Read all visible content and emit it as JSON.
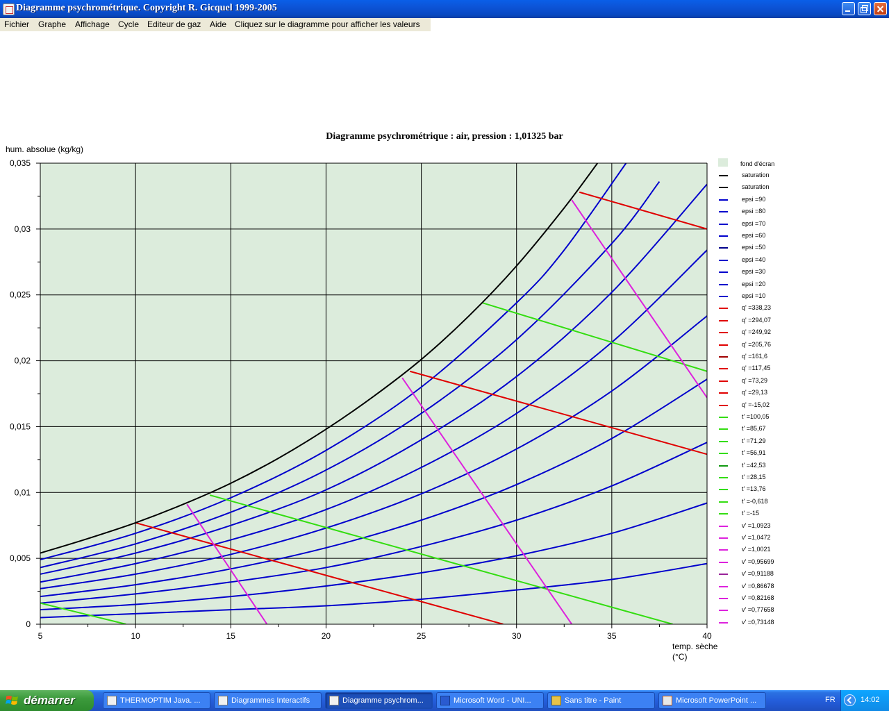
{
  "window": {
    "title": "Diagramme psychrométrique.    Copyright R. Gicquel 1999-2005"
  },
  "menu": {
    "items": [
      "Fichier",
      "Graphe",
      "Affichage",
      "Cycle",
      "Editeur de gaz",
      "Aide",
      "Cliquez sur le diagramme pour afficher les valeurs"
    ]
  },
  "colors": {
    "plot_bg": "#dcecdc",
    "grid": "#000000",
    "saturation": "#000000",
    "epsi": "#0000cc",
    "q": "#e00000",
    "t": "#33dd11",
    "v": "#dd22dd"
  },
  "chart_data": {
    "type": "line",
    "title": "Diagramme psychrométrique : air,  pression : 1,01325 bar",
    "xlabel_line1": "temp. sèche",
    "xlabel_line2": "(°C)",
    "ylabel": "hum. absolue (kg/kg)",
    "xlim": [
      5,
      40
    ],
    "ylim": [
      0,
      0.035
    ],
    "x_ticks": [
      "5",
      "10",
      "15",
      "20",
      "25",
      "30",
      "35",
      "40"
    ],
    "y_ticks": [
      "0",
      "0,005",
      "0,01",
      "0,015",
      "0,02",
      "0,025",
      "0,03",
      "0,035"
    ],
    "grid": true,
    "legend_position": "right",
    "saturation_curve": {
      "name": "saturation",
      "x": [
        5,
        7.5,
        10,
        12.5,
        15,
        17.5,
        20,
        22.5,
        25,
        27.5,
        30,
        32.5,
        34.25
      ],
      "y": [
        0.0054,
        0.0065,
        0.0077,
        0.0091,
        0.0107,
        0.0126,
        0.0148,
        0.0173,
        0.0201,
        0.0234,
        0.0272,
        0.0316,
        0.035
      ]
    },
    "relative_humidity_curves": [
      {
        "name": "epsi =90",
        "x": [
          5,
          10,
          15,
          20,
          25,
          30,
          32.5,
          35.75
        ],
        "y": [
          0.0049,
          0.0069,
          0.0096,
          0.0132,
          0.018,
          0.0244,
          0.0284,
          0.035
        ]
      },
      {
        "name": "epsi =80",
        "x": [
          5,
          10,
          15,
          20,
          25,
          30,
          35,
          37.5
        ],
        "y": [
          0.0043,
          0.0061,
          0.0085,
          0.0117,
          0.016,
          0.0216,
          0.0289,
          0.0336
        ]
      },
      {
        "name": "epsi =70",
        "x": [
          5,
          10,
          15,
          20,
          25,
          30,
          35,
          40
        ],
        "y": [
          0.0038,
          0.0054,
          0.0075,
          0.0102,
          0.014,
          0.0188,
          0.0252,
          0.0334
        ]
      },
      {
        "name": "epsi =60",
        "x": [
          5,
          10,
          15,
          20,
          25,
          30,
          35,
          40
        ],
        "y": [
          0.0032,
          0.0046,
          0.0064,
          0.0087,
          0.0119,
          0.016,
          0.0214,
          0.0284
        ]
      },
      {
        "name": "epsi =50",
        "x": [
          5,
          10,
          15,
          20,
          25,
          30,
          35,
          40
        ],
        "y": [
          0.0027,
          0.0038,
          0.0053,
          0.0073,
          0.0099,
          0.0133,
          0.0177,
          0.0234
        ]
      },
      {
        "name": "epsi =40",
        "x": [
          5,
          10,
          15,
          20,
          25,
          30,
          35,
          40
        ],
        "y": [
          0.0021,
          0.003,
          0.0042,
          0.0058,
          0.0079,
          0.0106,
          0.0141,
          0.0186
        ]
      },
      {
        "name": "epsi =30",
        "x": [
          5,
          10,
          15,
          20,
          25,
          30,
          35,
          40
        ],
        "y": [
          0.0016,
          0.0023,
          0.0032,
          0.0043,
          0.0059,
          0.0079,
          0.0105,
          0.0138
        ]
      },
      {
        "name": "epsi =20",
        "x": [
          5,
          10,
          15,
          20,
          25,
          30,
          35,
          40
        ],
        "y": [
          0.0011,
          0.0015,
          0.0021,
          0.0029,
          0.0039,
          0.0052,
          0.0069,
          0.0092
        ]
      },
      {
        "name": "epsi =10",
        "x": [
          5,
          10,
          15,
          20,
          25,
          30,
          35,
          40
        ],
        "y": [
          0.0005,
          0.0008,
          0.0011,
          0.0014,
          0.0019,
          0.0026,
          0.0034,
          0.0046
        ]
      }
    ],
    "enthalpy_lines": [
      {
        "name": "q' =338,23",
        "x": [
          33.3,
          40
        ],
        "y": [
          0.0328,
          0.03
        ]
      },
      {
        "name": "q' =294,07",
        "x": [],
        "y": []
      },
      {
        "name": "q' =249,92",
        "x": [],
        "y": []
      },
      {
        "name": "q' =205,76",
        "x": [],
        "y": []
      },
      {
        "name": "q' =161,6",
        "x": [],
        "y": []
      },
      {
        "name": "q' =117,45",
        "x": [
          24.4,
          40
        ],
        "y": [
          0.0192,
          0.0129
        ]
      },
      {
        "name": "q' =73,29",
        "x": [],
        "y": []
      },
      {
        "name": "q' =29,13",
        "x": [
          10,
          29.3
        ],
        "y": [
          0.0077,
          0.0
        ]
      },
      {
        "name": "q' =-15,02",
        "x": [],
        "y": []
      }
    ],
    "wet_bulb_lines": [
      {
        "name": "t' =100,05",
        "x": [],
        "y": []
      },
      {
        "name": "t' =85,67",
        "x": [],
        "y": []
      },
      {
        "name": "t' =71,29",
        "x": [],
        "y": []
      },
      {
        "name": "t' =56,91",
        "x": [],
        "y": []
      },
      {
        "name": "t' =42,53",
        "x": [
          28.2,
          40
        ],
        "y": [
          0.0244,
          0.0192
        ]
      },
      {
        "name": "t' =28,15",
        "x": [],
        "y": []
      },
      {
        "name": "t' =13,76",
        "x": [
          13.9,
          38.2
        ],
        "y": [
          0.0098,
          0.0
        ]
      },
      {
        "name": "t' =-0,618",
        "x": [
          5,
          9.5
        ],
        "y": [
          0.0016,
          0.0
        ]
      },
      {
        "name": "t' =-15",
        "x": [],
        "y": []
      }
    ],
    "specific_volume_lines": [
      {
        "name": "v' =1,0923",
        "x": [],
        "y": []
      },
      {
        "name": "v' =1,0472",
        "x": [],
        "y": []
      },
      {
        "name": "v' =1,0021",
        "x": [],
        "y": []
      },
      {
        "name": "v' =0,95699",
        "x": [],
        "y": []
      },
      {
        "name": "v' =0,91188",
        "x": [
          32.9,
          40
        ],
        "y": [
          0.0322,
          0.0172
        ]
      },
      {
        "name": "v' =0,86678",
        "x": [],
        "y": []
      },
      {
        "name": "v' =0,82168",
        "x": [
          24.0,
          32.9
        ],
        "y": [
          0.0187,
          0.0
        ]
      },
      {
        "name": "v' =0,77658",
        "x": [
          12.7,
          16.9
        ],
        "y": [
          0.0091,
          0.0
        ]
      },
      {
        "name": "v' =0,73148",
        "x": [],
        "y": []
      }
    ]
  },
  "legend": {
    "background_label": "fond d'écran",
    "items": [
      {
        "label": "saturation",
        "color": "#000000"
      },
      {
        "label": "saturation",
        "color": "#000000"
      },
      {
        "label": "epsi =90",
        "color": "#0000cc"
      },
      {
        "label": "epsi =80",
        "color": "#0000cc"
      },
      {
        "label": "epsi =70",
        "color": "#0000cc"
      },
      {
        "label": "epsi =60",
        "color": "#0000cc"
      },
      {
        "label": "epsi =50",
        "color": "#00008b"
      },
      {
        "label": "epsi =40",
        "color": "#0000cc"
      },
      {
        "label": "epsi =30",
        "color": "#0000cc"
      },
      {
        "label": "epsi =20",
        "color": "#0000cc"
      },
      {
        "label": "epsi =10",
        "color": "#0000cc"
      },
      {
        "label": "q' =338,23",
        "color": "#e00000"
      },
      {
        "label": "q' =294,07",
        "color": "#e00000"
      },
      {
        "label": "q' =249,92",
        "color": "#e00000"
      },
      {
        "label": "q' =205,76",
        "color": "#e00000"
      },
      {
        "label": "q' =161,6",
        "color": "#a00000"
      },
      {
        "label": "q' =117,45",
        "color": "#e00000"
      },
      {
        "label": "q' =73,29",
        "color": "#e00000"
      },
      {
        "label": "q' =29,13",
        "color": "#e00000"
      },
      {
        "label": "q' =-15,02",
        "color": "#e00000"
      },
      {
        "label": "t' =100,05",
        "color": "#33dd11"
      },
      {
        "label": "t' =85,67",
        "color": "#33dd11"
      },
      {
        "label": "t' =71,29",
        "color": "#33dd11"
      },
      {
        "label": "t' =56,91",
        "color": "#33dd11"
      },
      {
        "label": "t' =42,53",
        "color": "#119911"
      },
      {
        "label": "t' =28,15",
        "color": "#33dd11"
      },
      {
        "label": "t' =13,76",
        "color": "#33dd11"
      },
      {
        "label": "t' =-0,618",
        "color": "#33dd11"
      },
      {
        "label": "t' =-15",
        "color": "#33dd11"
      },
      {
        "label": "v' =1,0923",
        "color": "#dd22dd"
      },
      {
        "label": "v' =1,0472",
        "color": "#dd22dd"
      },
      {
        "label": "v' =1,0021",
        "color": "#dd22dd"
      },
      {
        "label": "v' =0,95699",
        "color": "#dd22dd"
      },
      {
        "label": "v' =0,91188",
        "color": "#992299"
      },
      {
        "label": "v' =0,86678",
        "color": "#dd22dd"
      },
      {
        "label": "v' =0,82168",
        "color": "#dd22dd"
      },
      {
        "label": "v' =0,77658",
        "color": "#dd22dd"
      },
      {
        "label": "v' =0,73148",
        "color": "#dd22dd"
      }
    ]
  },
  "taskbar": {
    "start_label": "démarrer",
    "tasks": [
      {
        "label": "THERMOPTIM Java. ...",
        "icon": "java-app-icon",
        "active": false
      },
      {
        "label": "Diagrammes Interactifs",
        "icon": "java-app-icon",
        "active": false
      },
      {
        "label": "Diagramme psychrom...",
        "icon": "java-app-icon",
        "active": true
      },
      {
        "label": "Microsoft Word - UNI...",
        "icon": "word-icon",
        "active": false
      },
      {
        "label": "Sans titre - Paint",
        "icon": "paint-icon",
        "active": false
      },
      {
        "label": "Microsoft PowerPoint ...",
        "icon": "powerpoint-icon",
        "active": false
      }
    ],
    "language": "FR",
    "clock": "14:02"
  }
}
